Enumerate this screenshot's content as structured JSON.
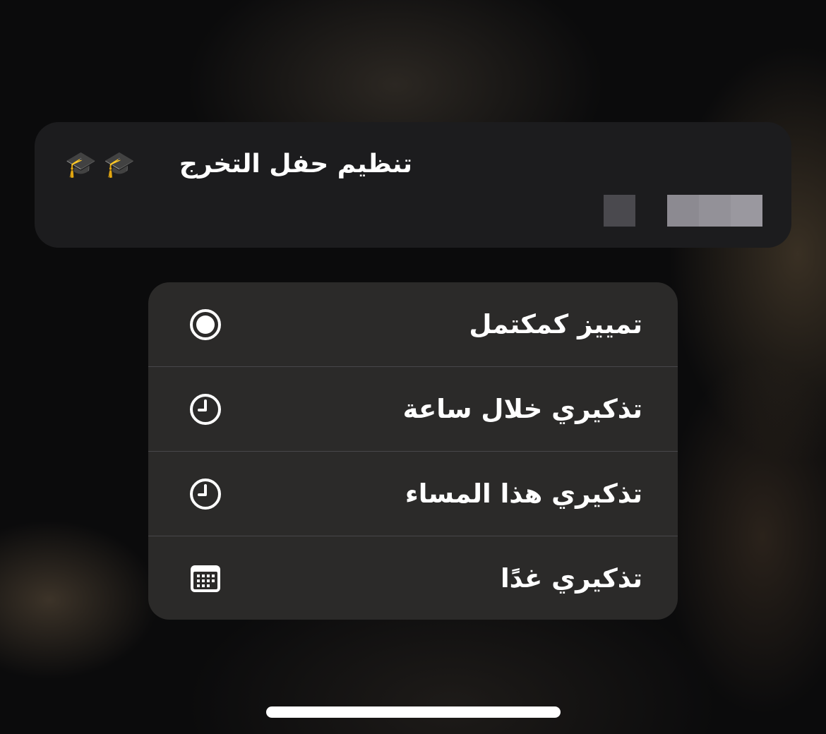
{
  "reminder_preview": {
    "title": "تنظيم حفل التخرج",
    "emoji": "🎓🎓"
  },
  "context_menu": {
    "items": [
      {
        "label": "تمييز كمكتمل",
        "icon": "circle-check-icon"
      },
      {
        "label": "تذكيري خلال ساعة",
        "icon": "clock-icon"
      },
      {
        "label": "تذكيري هذا المساء",
        "icon": "clock-icon"
      },
      {
        "label": "تذكيري غدًا",
        "icon": "calendar-icon"
      }
    ]
  },
  "colors": {
    "card_background": "#1c1c1e",
    "menu_background": "#2b2a29",
    "text": "#ffffff"
  }
}
